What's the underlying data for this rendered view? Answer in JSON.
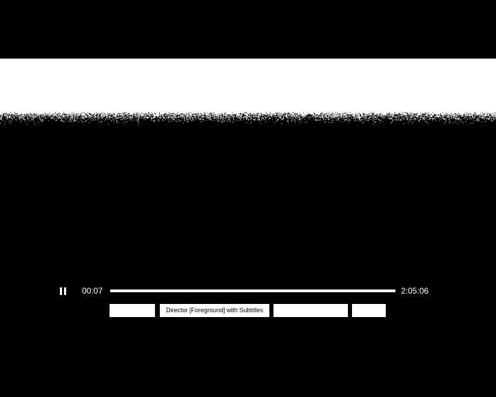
{
  "player": {
    "state": "playing",
    "elapsed": "00:07",
    "duration": "2:05:06",
    "progress_fraction": 0.0009,
    "pause_icon": "pause-icon",
    "colors": {
      "background": "#000000",
      "foreground": "#ffffff"
    }
  },
  "tracks": [
    {
      "label": ""
    },
    {
      "label": "Director [Foreground] with Subtitles"
    },
    {
      "label": ""
    },
    {
      "label": ""
    }
  ]
}
